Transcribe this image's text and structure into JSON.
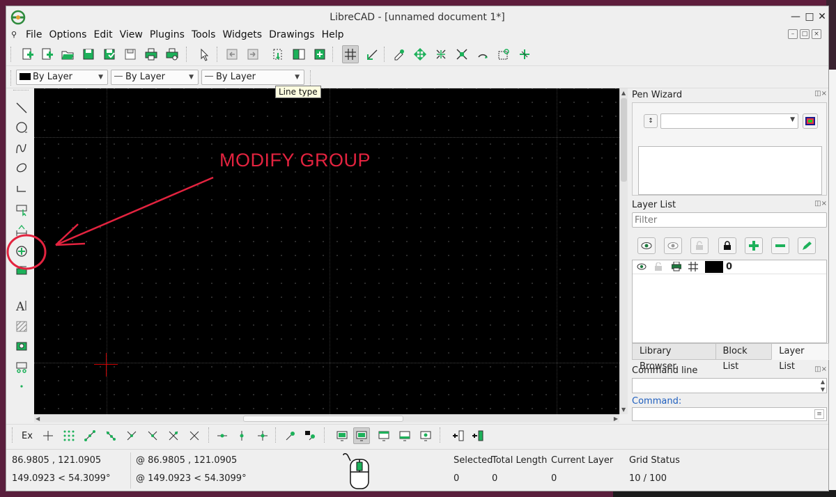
{
  "window": {
    "title": "LibreCAD - [unnamed document 1*]"
  },
  "menu": {
    "items": [
      {
        "label": "File"
      },
      {
        "label": "Options"
      },
      {
        "label": "Edit"
      },
      {
        "label": "View"
      },
      {
        "label": "Plugins"
      },
      {
        "label": "Tools"
      },
      {
        "label": "Widgets"
      },
      {
        "label": "Drawings"
      },
      {
        "label": "Help"
      }
    ]
  },
  "toolbar_pen": {
    "color": "By Layer",
    "width": "By Layer",
    "line_type": "By Layer"
  },
  "tooltip": "Line type",
  "annotation": {
    "text": "MODIFY GROUP",
    "color": "#e3233f"
  },
  "pen_wizard": {
    "title": "Pen Wizard",
    "color_value": ""
  },
  "layer_list": {
    "title": "Layer List",
    "filter_placeholder": "Filter",
    "layers": [
      {
        "name": "0",
        "color": "#000000"
      }
    ]
  },
  "dock_tabs": [
    {
      "label": "Library Browser",
      "active": false
    },
    {
      "label": "Block List",
      "active": false
    },
    {
      "label": "Layer List",
      "active": true
    }
  ],
  "command_line": {
    "title": "Command line",
    "prompt_label": "Command:"
  },
  "bottom_toolbar": {
    "ex_label": "Ex"
  },
  "status": {
    "abs_coords": "86.9805 , 121.0905",
    "abs_polar": "149.0923 < 54.3099°",
    "rel_coords": "@  86.9805 , 121.0905",
    "rel_polar": "@  149.0923 < 54.3099°",
    "selected_label": "Selected",
    "selected_value": "0",
    "total_length_label": "Total Length",
    "total_length_value": "0",
    "current_layer_label": "Current Layer",
    "current_layer_value": "0",
    "grid_status_label": "Grid Status",
    "grid_status_value": "10 / 100"
  },
  "colors": {
    "accent_green": "#1db15a",
    "canvas_bg": "#000000",
    "crosshair": "#cc0000"
  }
}
